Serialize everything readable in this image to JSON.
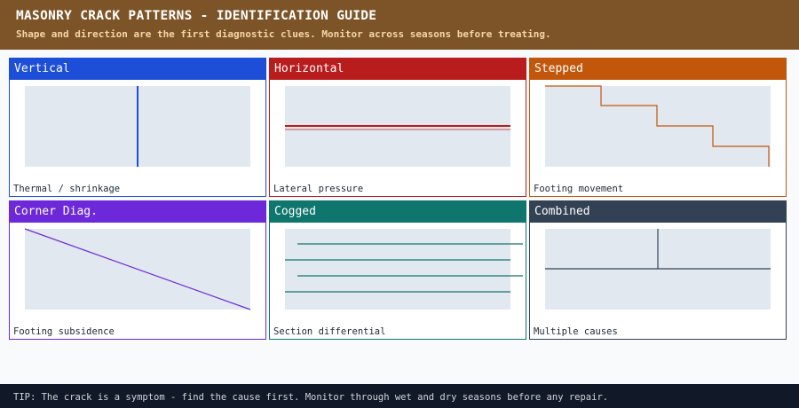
{
  "header": {
    "title": "MASONRY CRACK PATTERNS - IDENTIFICATION GUIDE",
    "subtitle": "Shape and direction are the first diagnostic clues. Monitor across seasons before treating."
  },
  "cards": [
    {
      "label": "Vertical",
      "cause": "Thermal / shrinkage",
      "color": "#1d4ed8",
      "pattern": "vertical"
    },
    {
      "label": "Horizontal",
      "cause": "Lateral pressure",
      "color": "#b91c1c",
      "pattern": "horizontal"
    },
    {
      "label": "Stepped",
      "cause": "Footing movement",
      "color": "#c2570c",
      "pattern": "stepped"
    },
    {
      "label": "Corner Diag.",
      "cause": "Footing subsidence",
      "color": "#6d28d9",
      "pattern": "diagonal"
    },
    {
      "label": "Cogged",
      "cause": "Section differential",
      "color": "#0f766e",
      "pattern": "cogged"
    },
    {
      "label": "Combined",
      "cause": "Multiple causes",
      "color": "#334155",
      "pattern": "combined"
    }
  ],
  "tip": "TIP: The crack is a symptom - find the cause first. Monitor through wet and dry seasons before any repair."
}
